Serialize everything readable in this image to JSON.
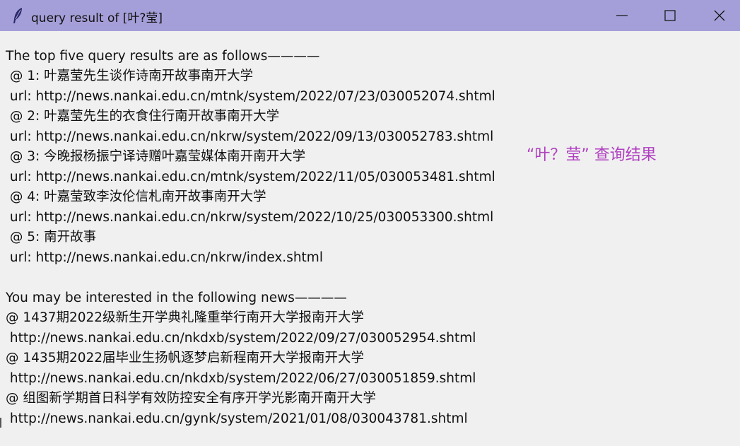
{
  "window": {
    "title": "query result of [叶?莹]"
  },
  "query_results": {
    "header": "The top five query results are as follows————",
    "items": [
      {
        "label": " @ 1: 叶嘉莹先生谈作诗南开故事南开大学",
        "url": " url: http://news.nankai.edu.cn/mtnk/system/2022/07/23/030052074.shtml"
      },
      {
        "label": " @ 2: 叶嘉莹先生的衣食住行南开故事南开大学",
        "url": " url: http://news.nankai.edu.cn/nkrw/system/2022/09/13/030052783.shtml"
      },
      {
        "label": " @ 3: 今晚报杨振宁译诗赠叶嘉莹媒体南开南开大学",
        "url": " url: http://news.nankai.edu.cn/mtnk/system/2022/11/05/030053481.shtml"
      },
      {
        "label": " @ 4: 叶嘉莹致李汝伦信札南开故事南开大学",
        "url": " url: http://news.nankai.edu.cn/nkrw/system/2022/10/25/030053300.shtml"
      },
      {
        "label": " @ 5: 南开故事",
        "url": " url: http://news.nankai.edu.cn/nkrw/index.shtml"
      }
    ]
  },
  "recommendations": {
    "header": "You may be interested in the following news————",
    "items": [
      {
        "label": "@ 1437期2022级新生开学典礼隆重举行南开大学报南开大学",
        "url": " http://news.nankai.edu.cn/nkdxb/system/2022/09/27/030052954.shtml"
      },
      {
        "label": "@ 1435期2022届毕业生扬帆逐梦启新程南开大学报南开大学",
        "url": " http://news.nankai.edu.cn/nkdxb/system/2022/06/27/030051859.shtml"
      },
      {
        "label": "@ 组图新学期首日科学有效防控安全有序开学光影南开南开大学",
        "url": " http://news.nankai.edu.cn/gynk/system/2021/01/08/030043781.shtml"
      }
    ]
  },
  "caption": "“叶？莹” 查询结果",
  "colors": {
    "titlebar": "#a59fd9",
    "content_bg": "#f0f0f0",
    "caption": "#b040c0"
  }
}
